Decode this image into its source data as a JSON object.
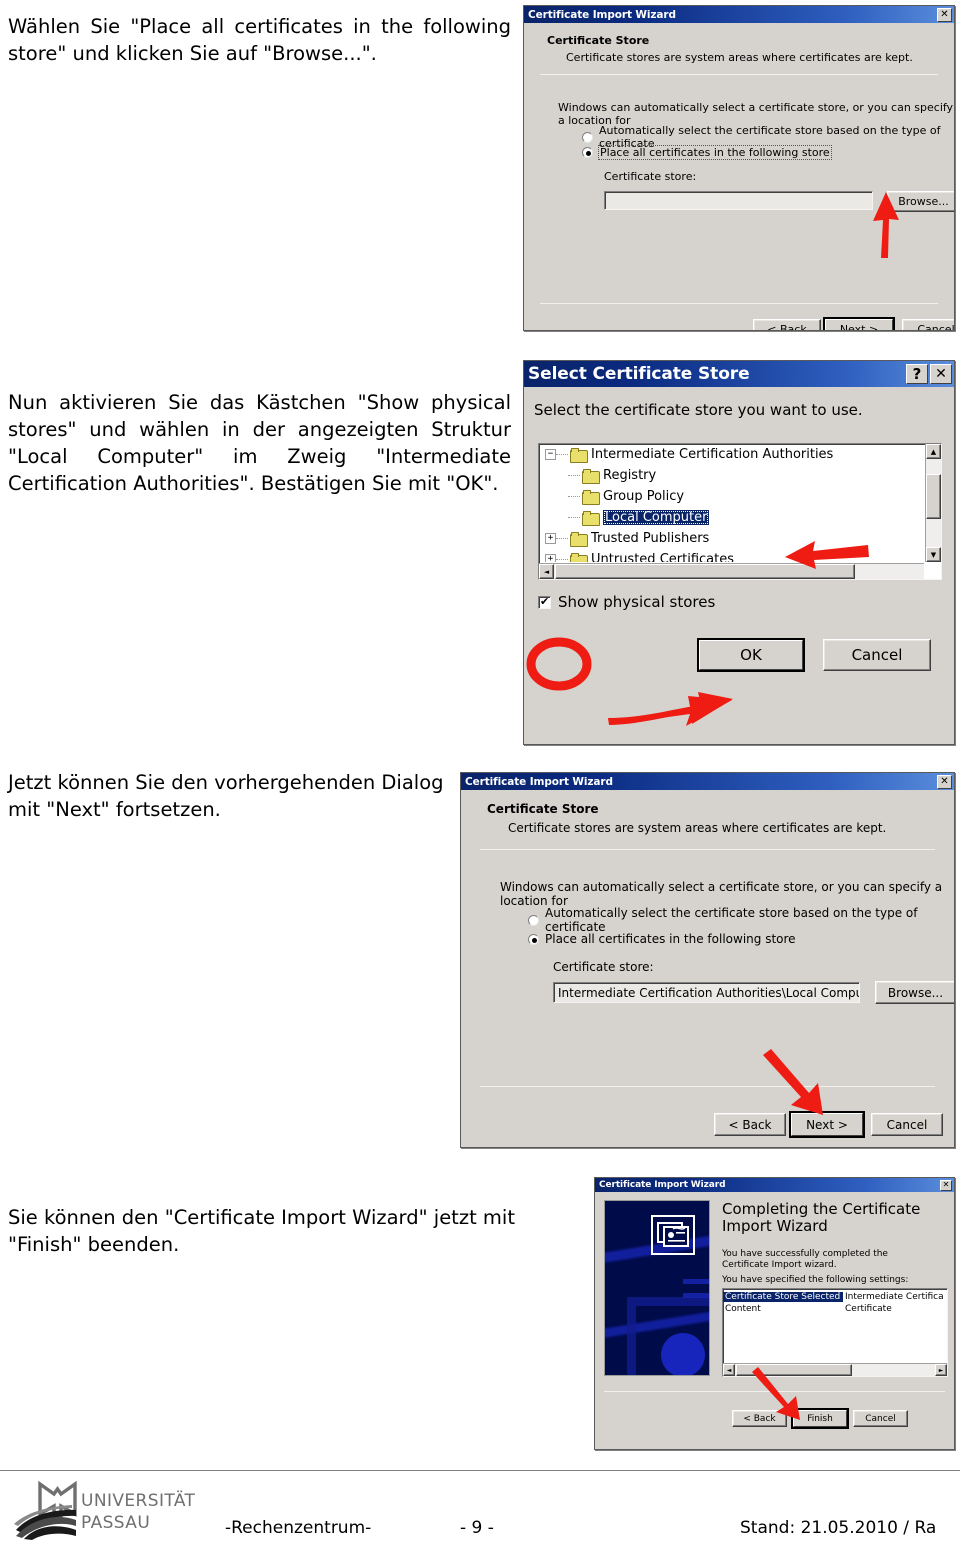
{
  "page": {
    "instructions": [
      {
        "id": "step1",
        "text": "Wählen Sie \"Place all certificates in the following store\" und klicken Sie auf \"Browse...\"."
      },
      {
        "id": "step2",
        "text": "Nun aktivieren Sie das Kästchen \"Show physical stores\" und wählen in der angezeigten Struktur \"Local Computer\" im Zweig \"Intermediate Certification Authorities\". Bestätigen Sie mit \"OK\"."
      },
      {
        "id": "step3",
        "text": "Jetzt können Sie den vorhergehenden Dialog mit \"Next\" fortsetzen."
      },
      {
        "id": "step4",
        "text": "Sie können den \"Certificate Import Wizard\" jetzt mit \"Finish\" beenden."
      }
    ]
  },
  "dialog1": {
    "title": "Certificate Import Wizard",
    "close_label": "✕",
    "header": "Certificate Store",
    "subheader": "Certificate stores are system areas where certificates are kept.",
    "intro": "Windows can automatically select a certificate store, or you can specify a location for",
    "radio_auto": "Automatically select the certificate store based on the type of certificate",
    "radio_place": "Place all certificates in the following store",
    "store_label": "Certificate store:",
    "store_value": "",
    "browse_label": "Browse...",
    "back_label": "< Back",
    "next_label": "Next >",
    "cancel_label": "Cancel"
  },
  "dialog2": {
    "title": "Select Certificate Store",
    "help_label": "?",
    "close_label": "✕",
    "prompt": "Select the certificate store you want to use.",
    "tree": [
      {
        "label": "Intermediate Certification Authorities",
        "indent": 0,
        "expander": "−",
        "selected": false
      },
      {
        "label": "Registry",
        "indent": 1,
        "expander": "",
        "selected": false
      },
      {
        "label": "Group Policy",
        "indent": 1,
        "expander": "",
        "selected": false
      },
      {
        "label": "Local Computer",
        "indent": 1,
        "expander": "",
        "selected": true
      },
      {
        "label": "Trusted Publishers",
        "indent": 0,
        "expander": "+",
        "selected": false
      },
      {
        "label": "Untrusted Certificates",
        "indent": 0,
        "expander": "+",
        "selected": false
      }
    ],
    "show_physical_label": "Show physical stores",
    "show_physical_checked": true,
    "ok_label": "OK",
    "cancel_label": "Cancel",
    "scroll_up": "▲",
    "scroll_down": "▼",
    "scroll_left": "◄",
    "scroll_right": "►"
  },
  "dialog3": {
    "title": "Certificate Import Wizard",
    "close_label": "✕",
    "header": "Certificate Store",
    "subheader": "Certificate stores are system areas where certificates are kept.",
    "intro": "Windows can automatically select a certificate store, or you can specify a location for",
    "radio_auto": "Automatically select the certificate store based on the type of certificate",
    "radio_place": "Place all certificates in the following store",
    "store_label": "Certificate store:",
    "store_value": "Intermediate Certification Authorities\\Local Computer",
    "browse_label": "Browse...",
    "back_label": "< Back",
    "next_label": "Next >",
    "cancel_label": "Cancel"
  },
  "dialog4": {
    "title": "Certificate Import Wizard",
    "close_label": "✕",
    "heading": "Completing the Certificate Import Wizard",
    "para1": "You have successfully completed the Certificate Import wizard.",
    "para2": "You have specified the following settings:",
    "settings": [
      {
        "name": "Certificate Store Selected by User",
        "value": "Intermediate Certifica",
        "selected": true
      },
      {
        "name": "Content",
        "value": "Certificate",
        "selected": false
      }
    ],
    "back_label": "< Back",
    "finish_label": "Finish",
    "cancel_label": "Cancel",
    "scroll_left": "◄",
    "scroll_right": "►"
  },
  "footer": {
    "logo_line1": "UNIVERSITÄT",
    "logo_line2": "PASSAU",
    "department": "-Rechenzentrum-",
    "page_number": "- 9 -",
    "date": "Stand: 21.05.2010 / Ra"
  },
  "colors": {
    "annotation_red": "#ee1c12",
    "titlebar_blue": "#0a246a",
    "dialog_face": "#d6d3ce",
    "selection_blue": "#0a246a"
  }
}
